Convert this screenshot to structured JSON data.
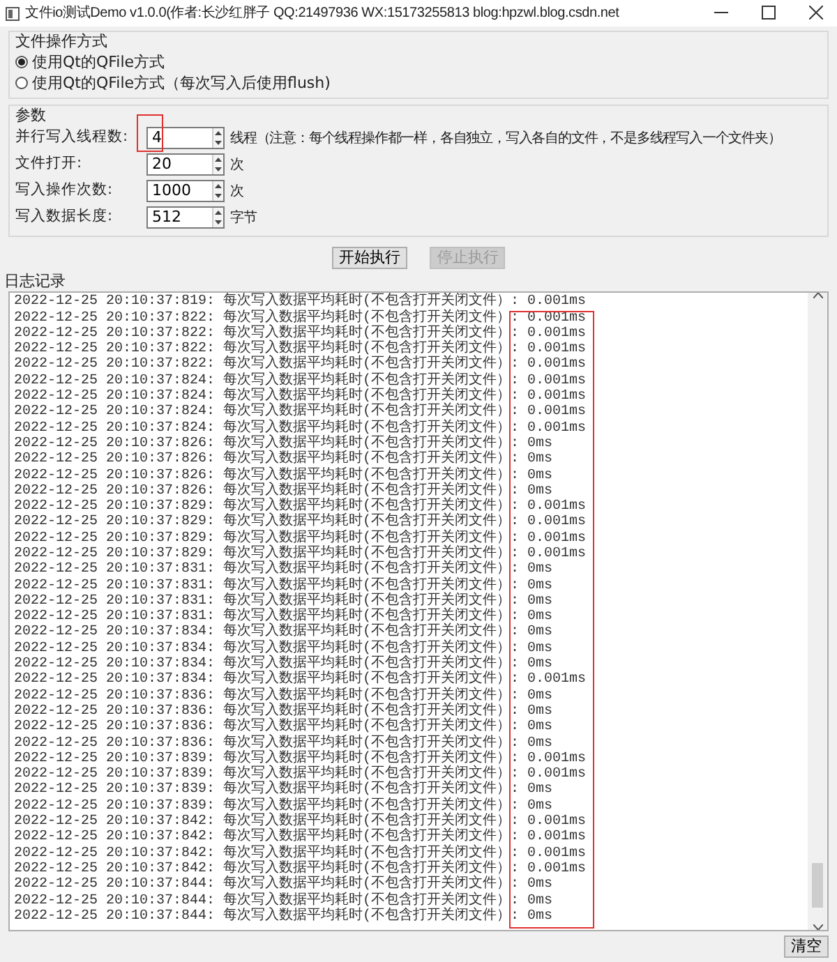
{
  "window": {
    "title": "文件io测试Demo v1.0.0(作者:长沙红胖子 QQ:21497936 WX:15173255813 blog:hpzwl.blog.csdn.net"
  },
  "mode_group": {
    "title": "文件操作方式",
    "options": [
      {
        "label": "使用Qt的QFile方式",
        "selected": true
      },
      {
        "label": "使用Qt的QFile方式（每次写入后使用flush)",
        "selected": false
      }
    ]
  },
  "params_group": {
    "title": "参数",
    "fields": [
      {
        "label": "并行写入线程数:",
        "value": "4",
        "unit": "线程（注意：每个线程操作都一样，各自独立，写入各自的文件，不是多线程写入一个文件夹）",
        "highlighted": true
      },
      {
        "label": "文件打开:",
        "value": "20",
        "unit": "次",
        "highlighted": false
      },
      {
        "label": "写入操作次数:",
        "value": "1000",
        "unit": "次",
        "highlighted": false
      },
      {
        "label": "写入数据长度:",
        "value": "512",
        "unit": "字节",
        "highlighted": false
      }
    ]
  },
  "actions": [
    {
      "label": "开始执行",
      "disabled": false
    },
    {
      "label": "停止执行",
      "disabled": true
    }
  ],
  "log": {
    "title": "日志记录",
    "highlight_values": true,
    "lines": [
      "2022-12-25 20:10:37:819: 每次写入数据平均耗时(不包含打开关闭文件）: 0.001ms",
      "2022-12-25 20:10:37:822: 每次写入数据平均耗时(不包含打开关闭文件）: 0.001ms",
      "2022-12-25 20:10:37:822: 每次写入数据平均耗时(不包含打开关闭文件）: 0.001ms",
      "2022-12-25 20:10:37:822: 每次写入数据平均耗时(不包含打开关闭文件）: 0.001ms",
      "2022-12-25 20:10:37:822: 每次写入数据平均耗时(不包含打开关闭文件）: 0.001ms",
      "2022-12-25 20:10:37:824: 每次写入数据平均耗时(不包含打开关闭文件）: 0.001ms",
      "2022-12-25 20:10:37:824: 每次写入数据平均耗时(不包含打开关闭文件）: 0.001ms",
      "2022-12-25 20:10:37:824: 每次写入数据平均耗时(不包含打开关闭文件）: 0.001ms",
      "2022-12-25 20:10:37:824: 每次写入数据平均耗时(不包含打开关闭文件）: 0.001ms",
      "2022-12-25 20:10:37:826: 每次写入数据平均耗时(不包含打开关闭文件）: 0ms",
      "2022-12-25 20:10:37:826: 每次写入数据平均耗时(不包含打开关闭文件）: 0ms",
      "2022-12-25 20:10:37:826: 每次写入数据平均耗时(不包含打开关闭文件）: 0ms",
      "2022-12-25 20:10:37:826: 每次写入数据平均耗时(不包含打开关闭文件）: 0ms",
      "2022-12-25 20:10:37:829: 每次写入数据平均耗时(不包含打开关闭文件）: 0.001ms",
      "2022-12-25 20:10:37:829: 每次写入数据平均耗时(不包含打开关闭文件）: 0.001ms",
      "2022-12-25 20:10:37:829: 每次写入数据平均耗时(不包含打开关闭文件）: 0.001ms",
      "2022-12-25 20:10:37:829: 每次写入数据平均耗时(不包含打开关闭文件）: 0.001ms",
      "2022-12-25 20:10:37:831: 每次写入数据平均耗时(不包含打开关闭文件）: 0ms",
      "2022-12-25 20:10:37:831: 每次写入数据平均耗时(不包含打开关闭文件）: 0ms",
      "2022-12-25 20:10:37:831: 每次写入数据平均耗时(不包含打开关闭文件）: 0ms",
      "2022-12-25 20:10:37:831: 每次写入数据平均耗时(不包含打开关闭文件）: 0ms",
      "2022-12-25 20:10:37:834: 每次写入数据平均耗时(不包含打开关闭文件）: 0ms",
      "2022-12-25 20:10:37:834: 每次写入数据平均耗时(不包含打开关闭文件）: 0ms",
      "2022-12-25 20:10:37:834: 每次写入数据平均耗时(不包含打开关闭文件）: 0ms",
      "2022-12-25 20:10:37:834: 每次写入数据平均耗时(不包含打开关闭文件）: 0.001ms",
      "2022-12-25 20:10:37:836: 每次写入数据平均耗时(不包含打开关闭文件）: 0ms",
      "2022-12-25 20:10:37:836: 每次写入数据平均耗时(不包含打开关闭文件）: 0ms",
      "2022-12-25 20:10:37:836: 每次写入数据平均耗时(不包含打开关闭文件）: 0ms",
      "2022-12-25 20:10:37:836: 每次写入数据平均耗时(不包含打开关闭文件）: 0ms",
      "2022-12-25 20:10:37:839: 每次写入数据平均耗时(不包含打开关闭文件）: 0.001ms",
      "2022-12-25 20:10:37:839: 每次写入数据平均耗时(不包含打开关闭文件）: 0.001ms",
      "2022-12-25 20:10:37:839: 每次写入数据平均耗时(不包含打开关闭文件）: 0ms",
      "2022-12-25 20:10:37:839: 每次写入数据平均耗时(不包含打开关闭文件）: 0ms",
      "2022-12-25 20:10:37:842: 每次写入数据平均耗时(不包含打开关闭文件）: 0.001ms",
      "2022-12-25 20:10:37:842: 每次写入数据平均耗时(不包含打开关闭文件）: 0.001ms",
      "2022-12-25 20:10:37:842: 每次写入数据平均耗时(不包含打开关闭文件）: 0.001ms",
      "2022-12-25 20:10:37:842: 每次写入数据平均耗时(不包含打开关闭文件）: 0.001ms",
      "2022-12-25 20:10:37:844: 每次写入数据平均耗时(不包含打开关闭文件）: 0ms",
      "2022-12-25 20:10:37:844: 每次写入数据平均耗时(不包含打开关闭文件）: 0ms",
      "2022-12-25 20:10:37:844: 每次写入数据平均耗时(不包含打开关闭文件）: 0ms"
    ]
  },
  "clear_button": {
    "label": "清空"
  }
}
